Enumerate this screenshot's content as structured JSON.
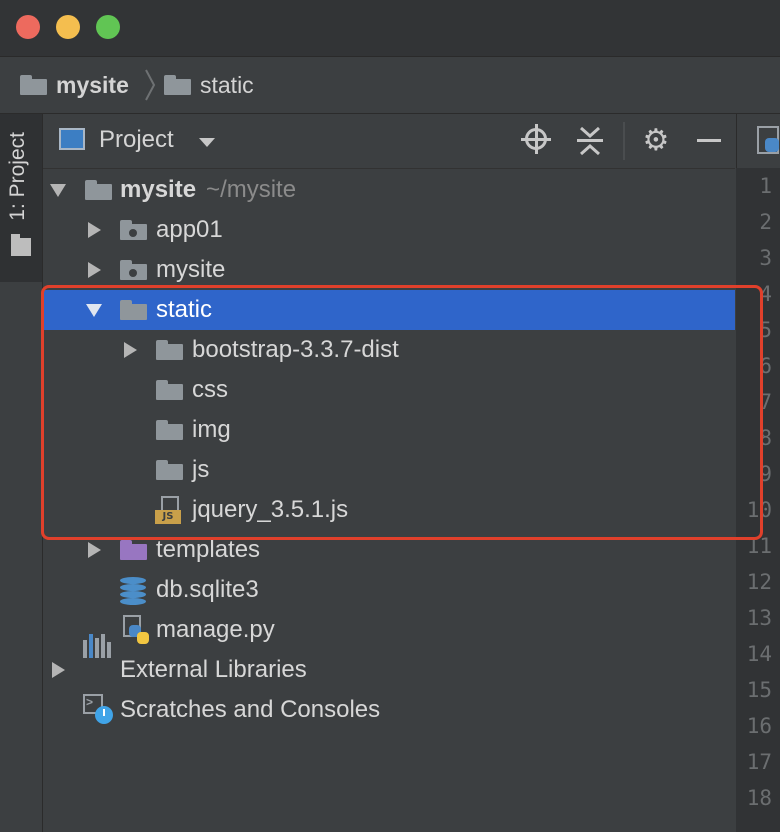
{
  "breadcrumb": {
    "items": [
      "mysite",
      "static"
    ]
  },
  "sidebar": {
    "tab_label": "1: Project"
  },
  "panel": {
    "title": "Project"
  },
  "tree": {
    "root": {
      "label": "mysite",
      "path_hint": "~/mysite"
    },
    "rows": [
      {
        "label": "app01"
      },
      {
        "label": "mysite"
      },
      {
        "label": "static"
      },
      {
        "label": "bootstrap-3.3.7-dist"
      },
      {
        "label": "css"
      },
      {
        "label": "img"
      },
      {
        "label": "js"
      },
      {
        "label": "jquery_3.5.1.js"
      },
      {
        "label": "templates"
      },
      {
        "label": "db.sqlite3"
      },
      {
        "label": "manage.py"
      },
      {
        "label": "External Libraries"
      },
      {
        "label": "Scratches and Consoles"
      }
    ],
    "selected": "static"
  },
  "file_badge": "JS",
  "gutter": {
    "line_numbers": [
      "1",
      "2",
      "3",
      "4",
      "5",
      "6",
      "7",
      "8",
      "9",
      "10",
      "11",
      "12",
      "13",
      "14",
      "15",
      "16",
      "17",
      "18"
    ]
  },
  "colors": {
    "selection": "#2f65ca",
    "highlight_border": "#e0402b",
    "templates_folder": "#9876c1",
    "db_icon": "#4b8ec9"
  },
  "icons": [
    "folder-icon",
    "package-folder-icon",
    "js-file-icon",
    "database-icon",
    "python-file-icon",
    "library-icon",
    "scratches-icon",
    "locate-icon",
    "collapse-all-icon",
    "gear-icon",
    "minimize-icon"
  ]
}
